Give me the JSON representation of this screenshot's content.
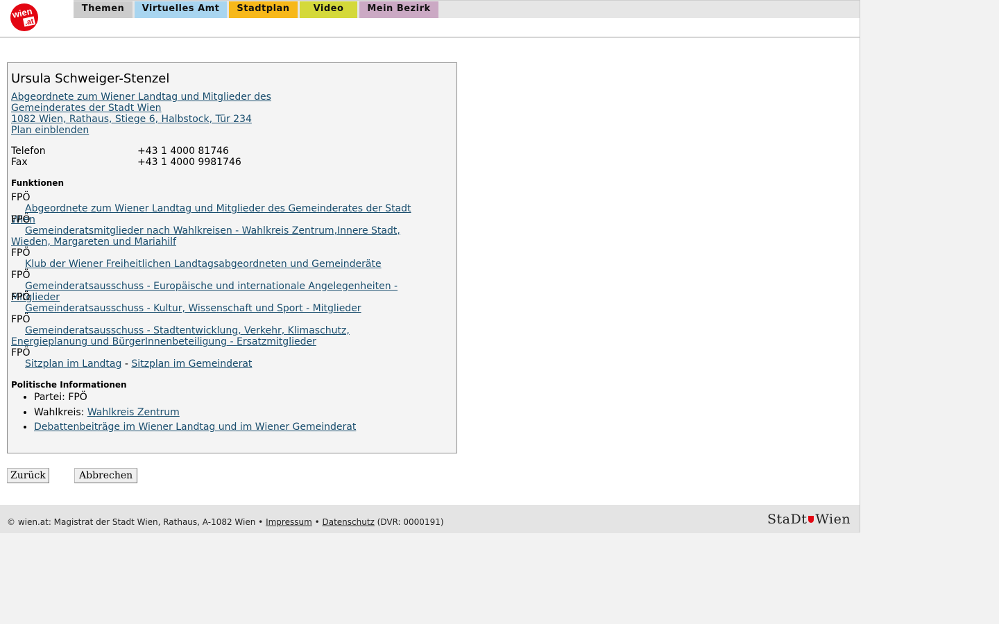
{
  "header": {
    "logo_text_top": "wien",
    "logo_text_bottom": ".at",
    "tabs": [
      {
        "label": "Themen",
        "color": "#cccccc"
      },
      {
        "label": "Virtuelles Amt",
        "color": "#a8d5f0"
      },
      {
        "label": "Stadtplan",
        "color": "#f7b81a"
      },
      {
        "label": "Video",
        "color": "#d4d93a"
      },
      {
        "label": "Mein Bezirk",
        "color": "#cba9c4"
      }
    ]
  },
  "person": {
    "name": "Ursula Schweiger-Stenzel",
    "subtitle": "Abgeordnete zum Wiener Landtag und Mitglieder des Gemeinderates der Stadt Wien",
    "address": "1082 Wien, Rathaus, Stiege 6, Halbstock, Tür 234",
    "plan_link": "Plan einblenden"
  },
  "contact": {
    "phone_label": "Telefon",
    "phone_value": "+43 1 4000 81746",
    "fax_label": "Fax",
    "fax_value": "+43 1 4000 9981746"
  },
  "functions": {
    "title": "Funktionen",
    "items": [
      {
        "party": "FPÖ",
        "link": "Abgeordnete zum Wiener Landtag und Mitglieder des Gemeinderates der Stadt Wien"
      },
      {
        "party": "FPÖ",
        "link": "Gemeinderatsmitglieder nach Wahlkreisen - Wahlkreis Zentrum,Innere Stadt, Wieden, Margareten und Mariahilf"
      },
      {
        "party": "FPÖ",
        "link": "Klub der Wiener Freiheitlichen Landtagsabgeordneten und Gemeinderäte"
      },
      {
        "party": "FPÖ",
        "link": "Gemeinderatsausschuss - Europäische und internationale Angelegenheiten - Mitglieder"
      },
      {
        "party": "FPÖ",
        "link": "Gemeinderatsausschuss - Kultur, Wissenschaft und Sport - Mitglieder"
      },
      {
        "party": "FPÖ",
        "link": "Gemeinderatsausschuss - Stadtentwicklung, Verkehr, Klimaschutz, Energieplanung und BürgerInnenbeteiligung - Ersatzmitglieder"
      }
    ],
    "last_party": "FPÖ",
    "seat_landtag": "Sitzplan im Landtag",
    "seat_separator": " - ",
    "seat_gemeinderat": "Sitzplan im Gemeinderat"
  },
  "political": {
    "title": "Politische Informationen",
    "party_label": "Partei: ",
    "party_value": "FPÖ",
    "district_label": "Wahlkreis: ",
    "district_link": "Wahlkreis Zentrum",
    "debates_link": "Debattenbeiträge im Wiener Landtag und im Wiener Gemeinderat"
  },
  "buttons": {
    "back": "Zurück",
    "cancel": "Abbrechen"
  },
  "footer": {
    "copyright": "© wien.at: Magistrat der Stadt Wien, Rathaus, A-1082 Wien • ",
    "impressum": "Impressum",
    "sep": " • ",
    "datenschutz": "Datenschutz",
    "dvr": " (DVR: 0000191)",
    "brand_left": "StaDt",
    "brand_right": "Wien"
  }
}
